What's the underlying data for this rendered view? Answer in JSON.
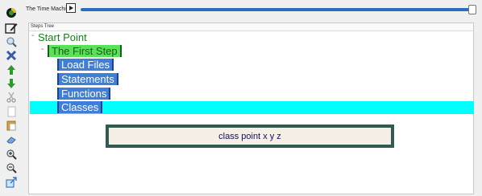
{
  "toolbar": {
    "icons": [
      "logo-icon",
      "edit-icon",
      "search-icon",
      "delete-icon",
      "move-up-icon",
      "move-down-icon",
      "cut-icon",
      "copy-icon",
      "paste-icon",
      "eraser-icon",
      "zoom-in-icon",
      "zoom-out-icon",
      "external-icon"
    ]
  },
  "topbar": {
    "title": "The Time Machine",
    "slider_value": 1.0
  },
  "tree": {
    "header": "Steps Tree",
    "root": "Start Point",
    "first_step": "The First Step",
    "children": [
      "Load Files",
      "Statements",
      "Functions",
      "Classes"
    ]
  },
  "popup": {
    "text": "class point x y z"
  }
}
